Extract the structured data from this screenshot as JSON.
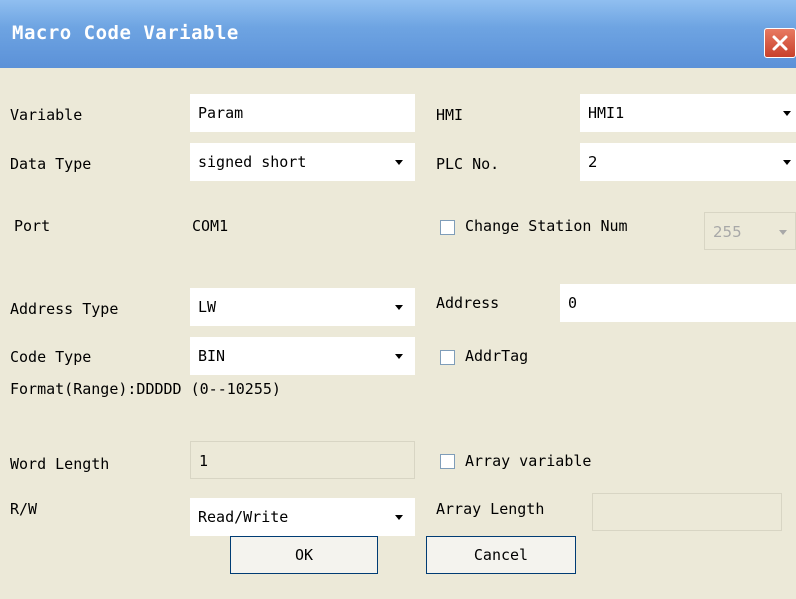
{
  "window": {
    "title": "Macro Code Variable",
    "close_icon": "close-icon"
  },
  "form": {
    "variable": {
      "label": "Variable",
      "value": "Param"
    },
    "hmi": {
      "label": "HMI",
      "value": "HMI1"
    },
    "data_type": {
      "label": "Data Type",
      "value": "signed short"
    },
    "plc_no": {
      "label": "PLC No.",
      "value": "2"
    },
    "port": {
      "label": "Port",
      "value": "COM1"
    },
    "change_station": {
      "label": "Change Station Num",
      "checked": false,
      "value": "255"
    },
    "address_type": {
      "label": "Address Type",
      "value": "LW"
    },
    "address": {
      "label": "Address",
      "value": "0"
    },
    "code_type": {
      "label": "Code Type",
      "value": "BIN"
    },
    "addr_tag": {
      "label": "AddrTag",
      "checked": false
    },
    "format_range": "Format(Range):DDDDD (0--10255)",
    "word_length": {
      "label": "Word Length",
      "value": "1"
    },
    "array_variable": {
      "label": "Array variable",
      "checked": false
    },
    "rw": {
      "label": "R/W",
      "value": "Read/Write"
    },
    "array_length": {
      "label": "Array Length",
      "value": ""
    }
  },
  "buttons": {
    "ok": "OK",
    "cancel": "Cancel"
  },
  "colors": {
    "titlebar": "#6ea4e2",
    "dialog_bg": "#ece9d8",
    "close_button": "#c8412b"
  }
}
